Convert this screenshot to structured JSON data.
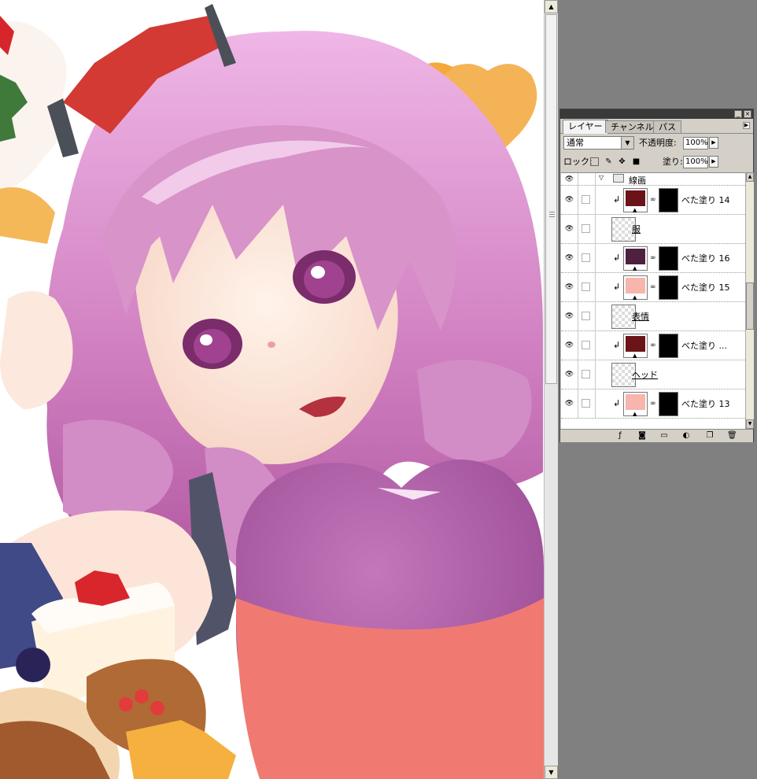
{
  "panel": {
    "tabs": [
      "レイヤー",
      "チャンネル",
      "パス"
    ],
    "blend_mode": "通常",
    "opacity_label": "不透明度:",
    "opacity_value": "100%",
    "lock_label": "ロック:",
    "fill_label": "塗り:",
    "fill_value": "100%"
  },
  "layers": [
    {
      "name": "線画",
      "kind": "group"
    },
    {
      "name": "べた塗り 14",
      "kind": "fill",
      "color": "#6b1418"
    },
    {
      "name": "服",
      "kind": "raster"
    },
    {
      "name": "べた塗り 16",
      "kind": "fill",
      "color": "#4f2140"
    },
    {
      "name": "べた塗り 15",
      "kind": "fill",
      "color": "#f7b5ad"
    },
    {
      "name": "表情",
      "kind": "raster"
    },
    {
      "name": "べた塗り ...",
      "kind": "fill",
      "color": "#6b1418"
    },
    {
      "name": "ヘッド",
      "kind": "raster"
    },
    {
      "name": "べた塗り 13",
      "kind": "fill",
      "color": "#f7b5ad"
    }
  ],
  "icons": {
    "eye": "eye-icon",
    "chain": "link-icon",
    "folder": "folder-icon",
    "lock_pixels": "lock-transparency-icon",
    "lock_brush": "lock-image-icon",
    "lock_move": "lock-position-icon",
    "lock_all": "lock-all-icon"
  }
}
